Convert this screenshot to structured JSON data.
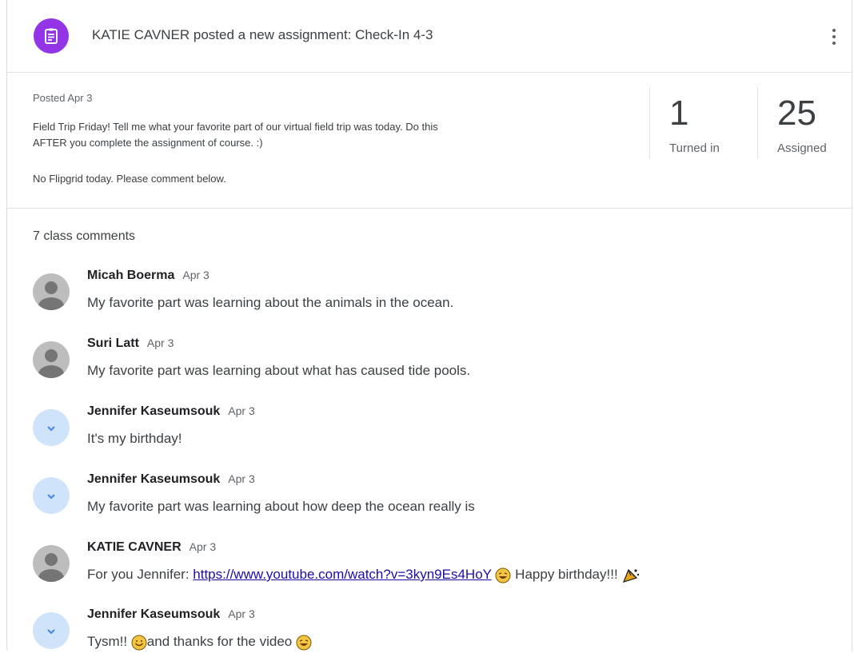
{
  "header": {
    "title": "KATIE CAVNER posted a new assignment: Check-In 4-3",
    "icon": "assignment-icon",
    "accent": "#9334e6"
  },
  "details": {
    "posted": "Posted Apr 3",
    "description_line1": "Field Trip Friday! Tell me what your favorite part of our virtual field trip was today. Do this",
    "description_line2": "AFTER you complete the assignment of course. :)",
    "description_extra": "No Flipgrid today. Please comment below.",
    "turned_in_count": "1",
    "turned_in_label": "Turned in",
    "assigned_count": "25",
    "assigned_label": "Assigned"
  },
  "comments_header": "7 class comments",
  "comments": [
    {
      "author": "Micah Boerma",
      "date": "Apr 3",
      "text": "My favorite part was learning about the animals in the ocean.",
      "avatar": "default-person-icon"
    },
    {
      "author": "Suri Latt",
      "date": "Apr 3",
      "text": "My favorite part was learning about what has caused tide pools.",
      "avatar": "default-person-icon"
    },
    {
      "author": "Jennifer Kaseumsouk",
      "date": "Apr 3",
      "text": "It's my birthday!",
      "avatar": "blue-avatar-icon"
    },
    {
      "author": "Jennifer Kaseumsouk",
      "date": "Apr 3",
      "text": "My favorite part was learning about how deep the ocean really is",
      "avatar": "blue-avatar-icon"
    },
    {
      "author": "KATIE CAVNER",
      "date": "Apr 3",
      "text_prefix": "For you Jennifer: ",
      "link": "https://www.youtube.com/watch?v=3kyn9Es4HoY",
      "text_suffix": " Happy birthday!!! ",
      "avatar": "default-person-icon"
    },
    {
      "author": "Jennifer Kaseumsouk",
      "date": "Apr 3",
      "text_prefix": "Tysm!! ",
      "text_middle": "and thanks for the video ",
      "avatar": "blue-avatar-icon"
    }
  ]
}
